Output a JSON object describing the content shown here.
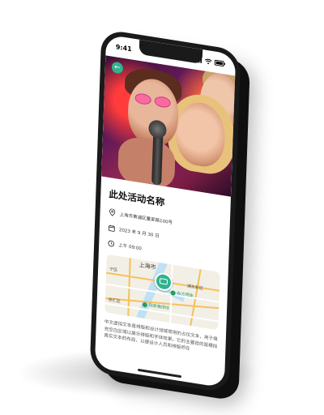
{
  "status_bar": {
    "time": "9:41"
  },
  "event": {
    "title": "此处活动名称",
    "address": "上海市黄浦区董家路100号",
    "date": "2023 年 9 月 30 日",
    "time": "上午 09:00"
  },
  "map": {
    "city_label": "上海市",
    "district_east": "浦东新区",
    "district_west": "宁区",
    "district_southwest": "徐汇区",
    "poi_1": "东方明珠",
    "poi_2": "陆家嘴绿地"
  },
  "description": "中文虚拟文本是排版和设计领域常用的占位文本，用于填充空白区域以展示排版和字体效果。它的主要目的是模拟真实文本的布局，以便设计人员和排版师在",
  "colors": {
    "accent": "#2fb38d",
    "phone_body": "#1a1a1a"
  },
  "icons": {
    "back": "arrow-left-icon",
    "address": "location-pin-icon",
    "date": "calendar-icon",
    "time": "clock-icon"
  }
}
